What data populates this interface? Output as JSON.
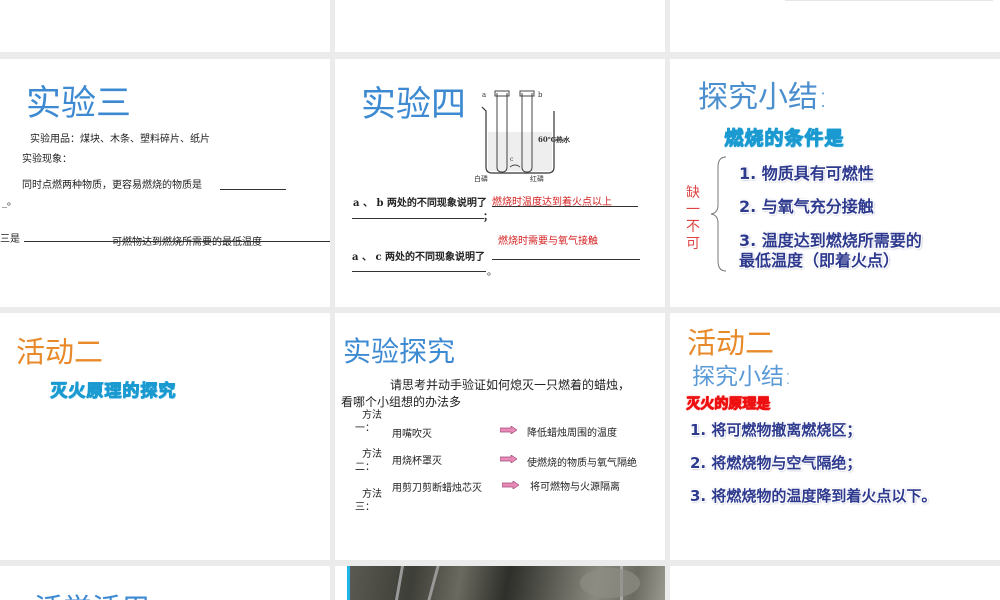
{
  "slides": {
    "exp3": {
      "title": "实验三",
      "line1": "实验用品：煤块、木条、塑料碎片、纸片",
      "line2": "实验现象：",
      "line3": "同时点燃两种物质，更容易燃烧的物质是",
      "line4": "_。",
      "line5": "三是",
      "answer": "可燃物达到燃烧所需要的最低温度"
    },
    "exp4": {
      "title": "实验四",
      "diagram": {
        "a": "a",
        "b": "b",
        "c": "c",
        "water": "60℃热水",
        "white_p": "白磷",
        "red_p": "红磷"
      },
      "q1": "a 、 b 两处的不同现象说明了",
      "a1": "燃烧时温度达到着火点以上",
      "q1_end": "；",
      "a2": "燃烧时需要与氧气接触",
      "q2": "a 、 c 两处的不同现象说明了",
      "q2_end": "。"
    },
    "summary1": {
      "title": "探究小结:",
      "subtitle": "燃烧的条件是",
      "side": "缺一不可",
      "items": [
        "1. 物质具有可燃性",
        "2. 与氧气充分接触",
        "3. 温度达到燃烧所需要的",
        "最低温度（即着火点）"
      ]
    },
    "activity2": {
      "title": "活动二",
      "subtitle": "灭火原理的探究"
    },
    "explore": {
      "title": "实验探究",
      "para1": "请思考并动手验证如何熄灭一只燃着的蜡烛，",
      "para2": "看哪个小组想的办法多",
      "methods": [
        {
          "label_a": "方法",
          "label_b": "一：",
          "action": "用嘴吹灭",
          "result": "降低蜡烛周围的温度"
        },
        {
          "label_a": "方法",
          "label_b": "二：",
          "action": "用烧杯罩灭",
          "result": "使燃烧的物质与氧气隔绝"
        },
        {
          "label_a": "方法",
          "label_b": "三：",
          "action": "用剪刀剪断蜡烛芯灭",
          "result": "将可燃物与火源隔离"
        }
      ]
    },
    "summary2": {
      "title": "活动二",
      "subtitle": "探究小结:",
      "heading": "灭火的原理是",
      "items": [
        "1. 将可燃物撤离燃烧区；",
        "2. 将燃烧物与空气隔绝；",
        "3. 将燃烧物的温度降到着火点以下。"
      ]
    },
    "apply": {
      "title": "活学活用"
    }
  },
  "colors": {
    "background": "#ebebeb",
    "title_blue": "#3d8ad2",
    "orange": "#e8892a",
    "red": "#d42020",
    "selection": "#1fb4e6"
  }
}
